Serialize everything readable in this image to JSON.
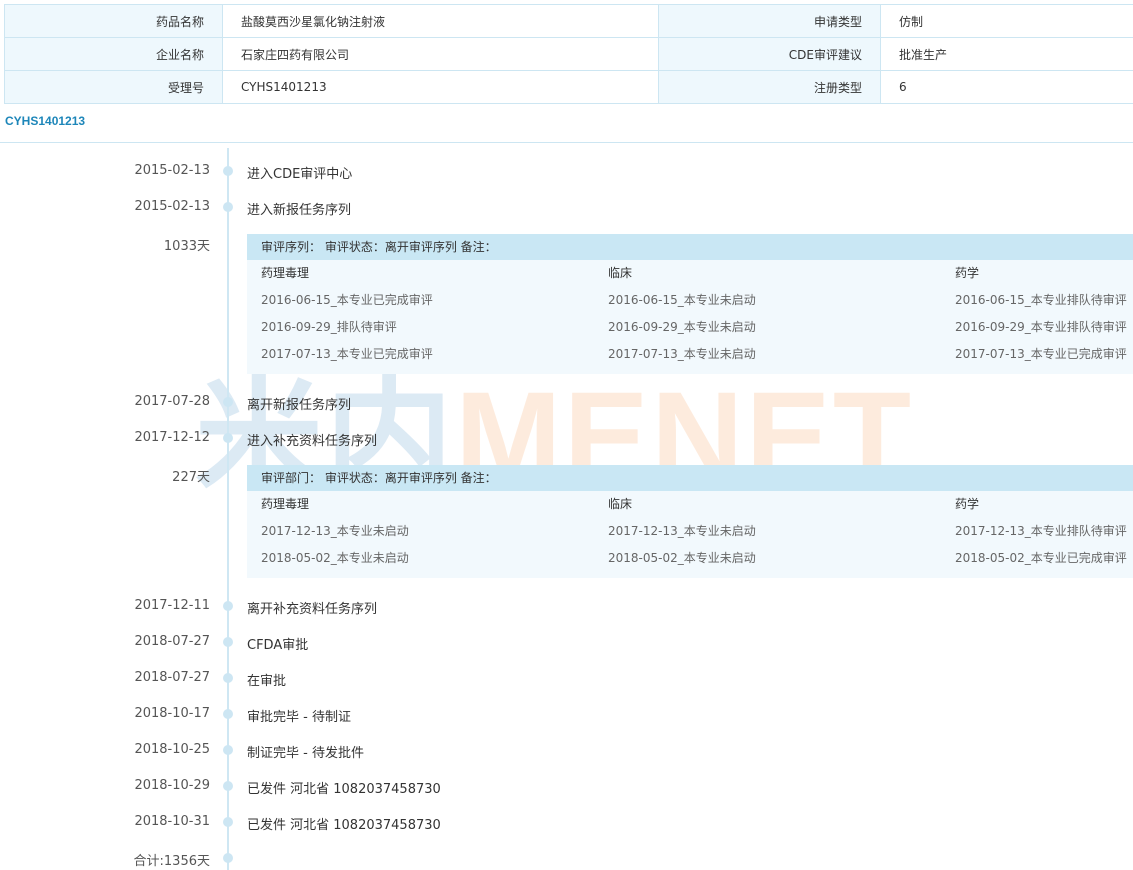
{
  "info": {
    "drug_name_label": "药品名称",
    "drug_name_value": "盐酸莫西沙星氯化钠注射液",
    "apply_type_label": "申请类型",
    "apply_type_value": "仿制",
    "company_label": "企业名称",
    "company_value": "石家庄四药有限公司",
    "cde_advice_label": "CDE审评建议",
    "cde_advice_value": "批准生产",
    "accept_no_label": "受理号",
    "accept_no_value": "CYHS1401213",
    "reg_type_label": "注册类型",
    "reg_type_value": "6"
  },
  "section_code": "CYHS1401213",
  "watermark": {
    "cn": "米内",
    "en": "MENET"
  },
  "timeline": [
    {
      "date": "2015-02-13",
      "text": "进入CDE审评中心"
    },
    {
      "date": "2015-02-13",
      "text": "进入新报任务序列"
    },
    {
      "date": "1033天",
      "text": ""
    },
    {
      "date": "2017-07-28",
      "text": "离开新报任务序列"
    },
    {
      "date": "2017-12-12",
      "text": "进入补充资料任务序列"
    },
    {
      "date": "227天",
      "text": ""
    },
    {
      "date": "2017-12-11",
      "text": "离开补充资料任务序列"
    },
    {
      "date": "2018-07-27",
      "text": "CFDA审批"
    },
    {
      "date": "2018-07-27",
      "text": "在审批"
    },
    {
      "date": "2018-10-17",
      "text": "审批完毕 - 待制证"
    },
    {
      "date": "2018-10-25",
      "text": "制证完毕 - 待发批件"
    },
    {
      "date": "2018-10-29",
      "text": "已发件 河北省 1082037458730"
    },
    {
      "date": "2018-10-31",
      "text": "已发件 河北省 1082037458730"
    },
    {
      "date": "合计:1356天",
      "text": ""
    }
  ],
  "review1": {
    "header": "审评序列：  审评状态：离开审评序列  备注：",
    "columns": [
      {
        "title": "药理毒理",
        "items": [
          "2016-06-15_本专业已完成审评",
          "2016-09-29_排队待审评",
          "2017-07-13_本专业已完成审评"
        ]
      },
      {
        "title": "临床",
        "items": [
          "2016-06-15_本专业未启动",
          "2016-09-29_本专业未启动",
          "2017-07-13_本专业未启动"
        ]
      },
      {
        "title": "药学",
        "items": [
          "2016-06-15_本专业排队待审评",
          "2016-09-29_本专业排队待审评",
          "2017-07-13_本专业已完成审评"
        ]
      }
    ]
  },
  "review2": {
    "header": "审评部门：  审评状态：离开审评序列  备注：",
    "columns": [
      {
        "title": "药理毒理",
        "items": [
          "2017-12-13_本专业未启动",
          "2018-05-02_本专业未启动"
        ]
      },
      {
        "title": "临床",
        "items": [
          "2017-12-13_本专业未启动",
          "2018-05-02_本专业未启动"
        ]
      },
      {
        "title": "药学",
        "items": [
          "2017-12-13_本专业排队待审评",
          "2018-05-02_本专业已完成审评"
        ]
      }
    ]
  },
  "colors": {
    "accent": "#1d86b9",
    "border": "#cde6f2",
    "label_bg": "#eef8fd",
    "review_head_bg": "#c9e7f4",
    "review_bg": "#f2f9fd"
  }
}
